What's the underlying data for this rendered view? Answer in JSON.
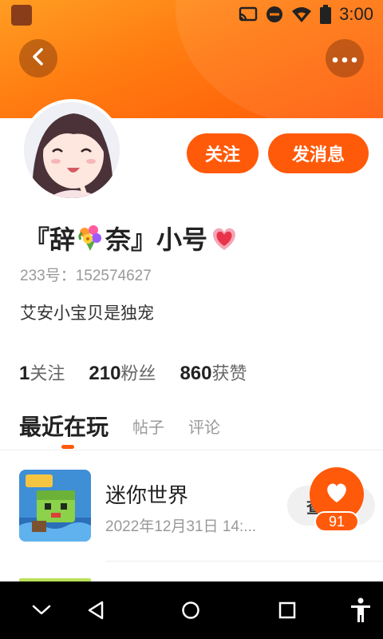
{
  "status_bar": {
    "time": "3:00",
    "icons": [
      "cast-icon",
      "do-not-disturb-icon",
      "wifi-icon",
      "battery-icon"
    ]
  },
  "header": {
    "back_icon": "chevron-left-icon",
    "more_icon": "more-horizontal-icon",
    "accent_color": "#ff5a0a"
  },
  "profile": {
    "avatar": "anime-girl-avatar",
    "nickname_prefix": "『辞",
    "nickname_middle": "奈』小号",
    "nickname_emojis": [
      "bouquet-emoji",
      "sparkling-heart-emoji"
    ],
    "user_id": "233号：152574627",
    "bio": "艾安小宝贝是独宠"
  },
  "actions": {
    "follow_label": "关注",
    "message_label": "发消息"
  },
  "stats": [
    {
      "value": "1",
      "label": "关注"
    },
    {
      "value": "210",
      "label": "粉丝"
    },
    {
      "value": "860",
      "label": "获赞"
    }
  ],
  "tabs": [
    {
      "label": "最近在玩",
      "active": true
    },
    {
      "label": "帖子",
      "active": false
    },
    {
      "label": "评论",
      "active": false
    }
  ],
  "recent_games": [
    {
      "name": "迷你世界",
      "time": "2022年12月31日 14:...",
      "button_label": "查看"
    }
  ],
  "like_fab": {
    "icon": "heart-icon",
    "count": "91"
  },
  "nav_bar": {
    "icons": [
      "chevron-down-icon",
      "back-triangle-icon",
      "home-circle-icon",
      "recents-square-icon",
      "accessibility-icon"
    ]
  }
}
